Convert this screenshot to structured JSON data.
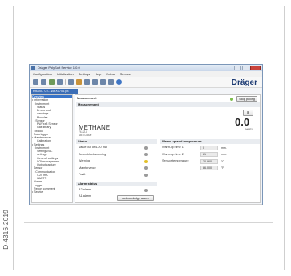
{
  "figure_id": "D-4316-2019",
  "window": {
    "title": "Dräger PolySoft Service 1.0.0",
    "menu": [
      "Configuration",
      "Initialization",
      "Settings",
      "Help",
      "Extras",
      "Service"
    ],
    "brand": "Dräger",
    "doc_tab": "P8000 - C:\\...\\BFX0706.p8"
  },
  "tree": [
    {
      "label": "Overview",
      "selected": true
    },
    {
      "label": "• Information"
    },
    {
      "label": "  • Instrument"
    },
    {
      "label": "      Status"
    },
    {
      "label": "      Errors and"
    },
    {
      "label": "      warnings"
    },
    {
      "label": "      Modules"
    },
    {
      "label": "  • Sensor"
    },
    {
      "label": "      PW7xx8 Sensor"
    },
    {
      "label": "      Gas library"
    },
    {
      "label": "  Tilt lock"
    },
    {
      "label": "  Data logger"
    },
    {
      "label": "• Maintenance"
    },
    {
      "label": "      Calibration"
    },
    {
      "label": "• Settings"
    },
    {
      "label": "  • Instrument"
    },
    {
      "label": "      Settings/SIL"
    },
    {
      "label": "      settings"
    },
    {
      "label": "      General settings"
    },
    {
      "label": "      SOI management"
    },
    {
      "label": "      Output capture"
    },
    {
      "label": "  Sensor"
    },
    {
      "label": "  • Communication"
    },
    {
      "label": "      4-20 mA"
    },
    {
      "label": "      HART®"
    },
    {
      "label": "  Alarms"
    },
    {
      "label": "  Logger"
    },
    {
      "label": "  Report comment"
    },
    {
      "label": "• Service"
    }
  ],
  "measurement": {
    "header": "Measurement",
    "sub": "Measurement",
    "gas": "METHANE",
    "detail_lines": [
      "74-82-8",
      "ME 7L0800"
    ],
    "value": "0.0",
    "unit": "%LEL",
    "stop_button": "Stop polling"
  },
  "status": {
    "header": "Status",
    "rows": [
      "Value out of 4-20 mA",
      "Beam block warning",
      "Warning",
      "Maintenance",
      "Fault"
    ],
    "dot_colors": [
      "#9a9a9a",
      "#9a9a9a",
      "#e3c12a",
      "#9a9a9a",
      "#9a9a9a"
    ]
  },
  "warmup": {
    "header": "Warm-up and temperature",
    "rows": [
      {
        "label": "Warm-up time 1",
        "value": "0",
        "unit": "min."
      },
      {
        "label": "Warm-up time 2",
        "value": "81",
        "unit": "min."
      },
      {
        "label": "Sensor temperature",
        "value": "30.960",
        "unit": "°C"
      },
      {
        "label": "",
        "value": "86.000",
        "unit": "°F"
      }
    ]
  },
  "alarm": {
    "header": "Alarm status",
    "rows": [
      "A2 alarm",
      "A1 alarm"
    ],
    "ack_button": "Acknowledge alarm"
  }
}
